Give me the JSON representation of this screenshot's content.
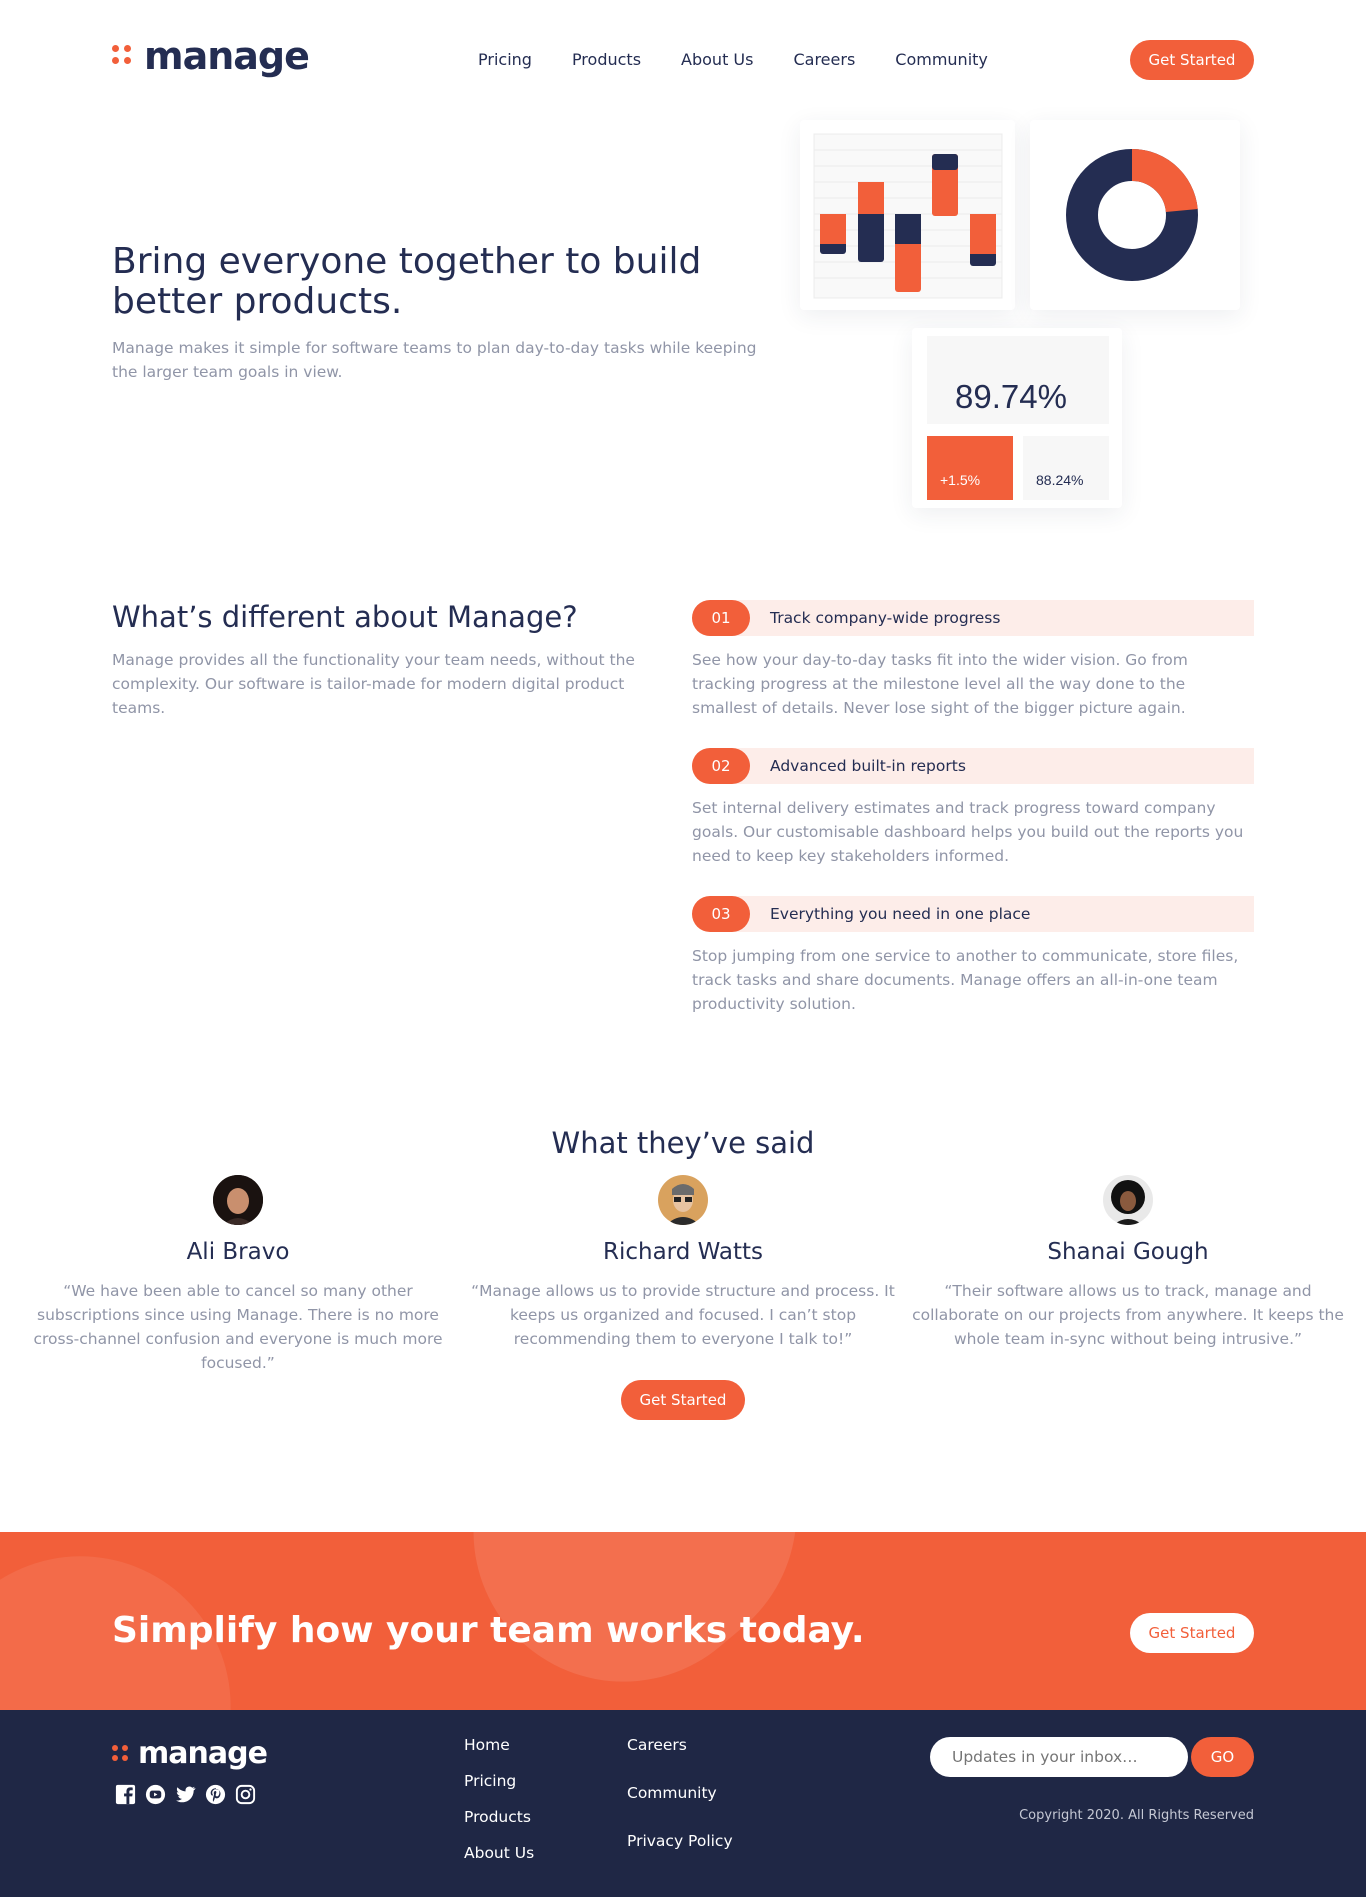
{
  "header": {
    "logo_text": "manage",
    "nav": [
      "Pricing",
      "Products",
      "About Us",
      "Careers",
      "Community"
    ],
    "cta": "Get Started"
  },
  "hero": {
    "title": "Bring everyone together to build better products.",
    "subtitle": "Manage makes it simple for software teams to plan day-to-day tasks while keeping the larger team goals in view.",
    "stats": {
      "main": "89.74%",
      "change": "+1.5%",
      "secondary": "88.24%"
    }
  },
  "different": {
    "title": "What’s different about Manage?",
    "subtitle": "Manage provides all the functionality your team needs, without the complexity. Our software is tailor-made for modern digital product teams.",
    "features": [
      {
        "num": "01",
        "title": "Track company-wide progress",
        "body": "See how your day-to-day tasks fit into the wider vision. Go from tracking progress at the milestone level all the way done to the smallest of details. Never lose sight of the bigger picture again."
      },
      {
        "num": "02",
        "title": "Advanced built-in reports",
        "body": "Set internal delivery estimates and track progress toward company goals. Our customisable dashboard helps you build out the reports you need to keep key stakeholders informed."
      },
      {
        "num": "03",
        "title": "Everything you need in one place",
        "body": "Stop jumping from one service to another to communicate, store files, track tasks and share documents. Manage offers an all-in-one team productivity solution."
      }
    ]
  },
  "testimonials": {
    "title": "What they’ve said",
    "items": [
      {
        "name": "Ali Bravo",
        "quote": "“We have been able to cancel so many other subscriptions since using Manage. There is no more cross-channel confusion and everyone is much more focused.”"
      },
      {
        "name": "Richard Watts",
        "quote": "“Manage allows us to provide structure and process. It keeps us organized and focused. I can’t stop recommending them to everyone I talk to!”"
      },
      {
        "name": "Shanai Gough",
        "quote": "“Their software allows us to track, manage and collaborate on our projects from anywhere. It keeps the whole team in-sync without being intrusive.”"
      }
    ],
    "cta": "Get Started"
  },
  "cta_band": {
    "text": "Simplify how your team works today.",
    "button": "Get Started"
  },
  "footer": {
    "logo_text": "manage",
    "socials": [
      "facebook-icon",
      "youtube-icon",
      "twitter-icon",
      "pinterest-icon",
      "instagram-icon"
    ],
    "col1": [
      "Home",
      "Pricing",
      "Products",
      "About Us"
    ],
    "col2": [
      "Careers",
      "Community",
      "Privacy Policy"
    ],
    "input_placeholder": "Updates in your inbox…",
    "go": "GO",
    "copyright": "Copyright 2020. All Rights Reserved"
  },
  "colors": {
    "accent": "#f25f3a",
    "navy": "#242d52",
    "footer_bg": "#1f2745",
    "muted": "#9095a7",
    "feature_tint": "#fdede9"
  }
}
